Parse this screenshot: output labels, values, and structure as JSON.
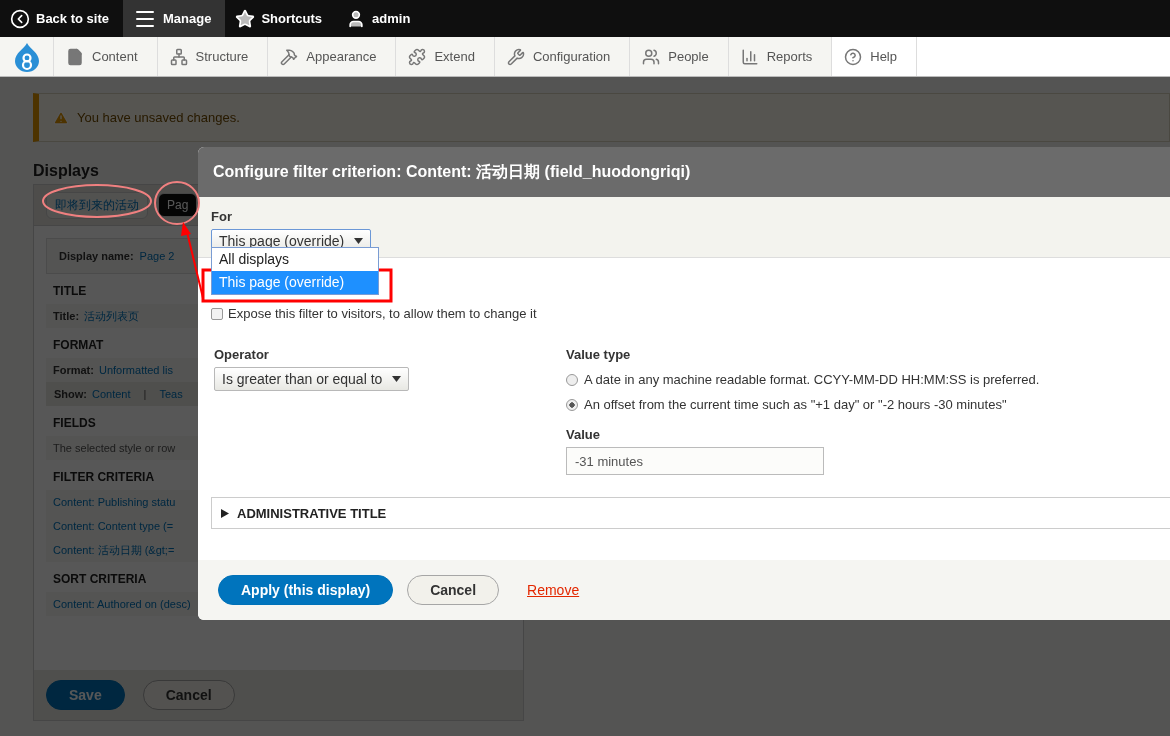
{
  "toolbar": {
    "items": [
      {
        "label": "Back to site",
        "selected": false
      },
      {
        "label": "Manage",
        "selected": true
      },
      {
        "label": "Shortcuts",
        "selected": false
      },
      {
        "label": "admin",
        "selected": false
      }
    ]
  },
  "admin_menu": {
    "items": [
      {
        "label": "Content",
        "selected": false
      },
      {
        "label": "Structure",
        "selected": false
      },
      {
        "label": "Appearance",
        "selected": false
      },
      {
        "label": "Extend",
        "selected": false
      },
      {
        "label": "Configuration",
        "selected": false
      },
      {
        "label": "People",
        "selected": false
      },
      {
        "label": "Reports",
        "selected": false
      },
      {
        "label": "Help",
        "selected": true
      }
    ]
  },
  "message": "You have unsaved changes.",
  "displays": {
    "title": "Displays",
    "tabs": [
      {
        "label": "即将到来的活动",
        "selected": false
      },
      {
        "label": "Pag",
        "selected": true
      }
    ],
    "display_name": {
      "label": "Display name:",
      "value": "Page 2"
    },
    "sections": [
      {
        "heading": "TITLE",
        "rows": [
          {
            "kind": "pair",
            "label": "Title:",
            "value": "活动列表页"
          }
        ]
      },
      {
        "heading": "FORMAT",
        "rows": [
          {
            "kind": "pair",
            "label": "Format:",
            "value": "Unformatted lis"
          },
          {
            "kind": "show",
            "label": "Show:",
            "value": "Content",
            "separator": "|",
            "extra": "Teas"
          }
        ]
      },
      {
        "heading": "FIELDS",
        "rows": [
          {
            "kind": "note",
            "text": "The selected style or row"
          }
        ]
      },
      {
        "heading": "FILTER CRITERIA",
        "rows": [
          {
            "kind": "link",
            "text": "Content: Publishing statu"
          },
          {
            "kind": "link",
            "text": "Content: Content type (="
          },
          {
            "kind": "link",
            "text": "Content: 活动日期 (&gt;="
          }
        ]
      },
      {
        "heading": "SORT CRITERIA",
        "rows": [
          {
            "kind": "link",
            "text": "Content: Authored on (desc)"
          }
        ]
      }
    ],
    "buttons": {
      "save": "Save",
      "cancel": "Cancel"
    }
  },
  "dialog": {
    "title": "Configure filter criterion: Content: 活动日期 (field_huodongriqi)",
    "for": {
      "label": "For",
      "value": "This page (override)",
      "options": [
        {
          "label": "All displays",
          "selected": false
        },
        {
          "label": "This page (override)",
          "selected": true
        }
      ]
    },
    "expose": {
      "label": "Expose this filter to visitors, to allow them to change it",
      "checked": false
    },
    "operator": {
      "label": "Operator",
      "value": "Is greater than or equal to"
    },
    "value_type": {
      "label": "Value type",
      "options": [
        {
          "label": "A date in any machine readable format. CCYY-MM-DD HH:MM:SS is preferred.",
          "selected": false
        },
        {
          "label": "An offset from the current time such as \"+1 day\" or \"-2 hours -30 minutes\"",
          "selected": true
        }
      ]
    },
    "value": {
      "label": "Value",
      "value": "-31 minutes"
    },
    "details": {
      "label": "ADMINISTRATIVE TITLE",
      "expanded": false
    },
    "actions": {
      "apply": "Apply (this display)",
      "cancel": "Cancel",
      "remove": "Remove"
    }
  }
}
